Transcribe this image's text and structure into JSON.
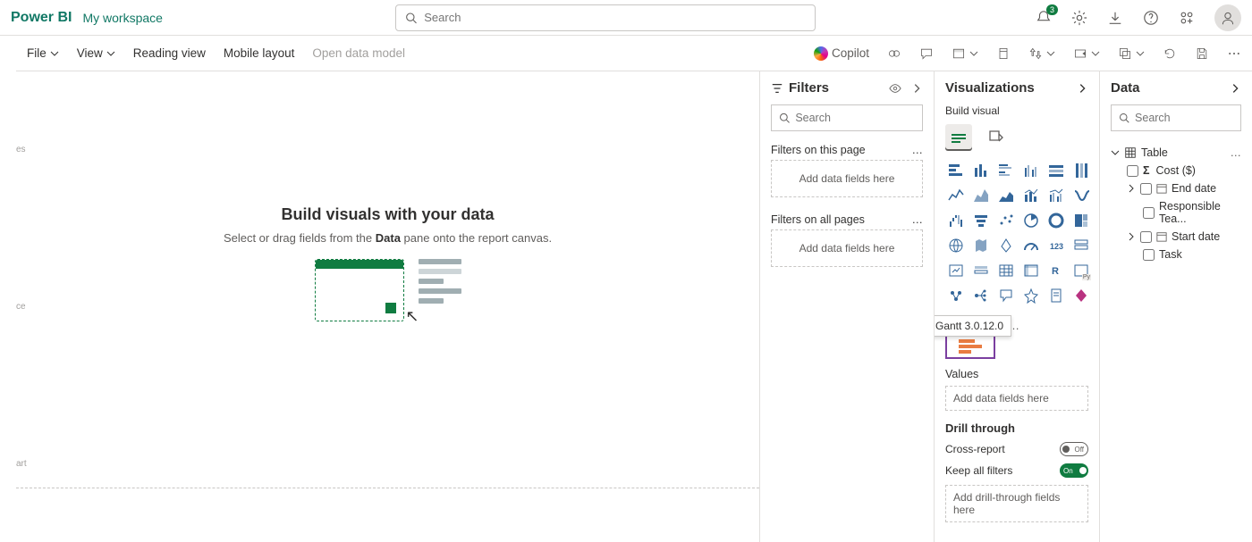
{
  "header": {
    "brand": "Power BI",
    "workspace": "My workspace",
    "search_placeholder": "Search",
    "notif_badge": "3"
  },
  "cmdbar": {
    "file": "File",
    "view": "View",
    "reading": "Reading view",
    "mobile": "Mobile layout",
    "open_model": "Open data model",
    "copilot": "Copilot"
  },
  "canvas": {
    "title": "Build visuals with your data",
    "subtitle_pre": "Select or drag fields from the ",
    "subtitle_bold": "Data",
    "subtitle_post": " pane onto the report canvas."
  },
  "filters": {
    "title": "Filters",
    "search_placeholder": "Search",
    "section_page": "Filters on this page",
    "section_all": "Filters on all pages",
    "drop_text": "Add data fields here"
  },
  "viz": {
    "title": "Visualizations",
    "sub": "Build visual",
    "tooltip": "Gantt 3.0.12.0",
    "values_label": "Values",
    "values_drop": "Add data fields here",
    "drill_title": "Drill through",
    "cross_report": "Cross-report",
    "cross_report_state": "Off",
    "keep_filters": "Keep all filters",
    "keep_filters_state": "On",
    "drill_drop": "Add drill-through fields here"
  },
  "data": {
    "title": "Data",
    "search_placeholder": "Search",
    "table": "Table",
    "fields": {
      "cost": "Cost ($)",
      "end_date": "End date",
      "resp_team": "Responsible Tea...",
      "start_date": "Start date",
      "task": "Task"
    }
  }
}
